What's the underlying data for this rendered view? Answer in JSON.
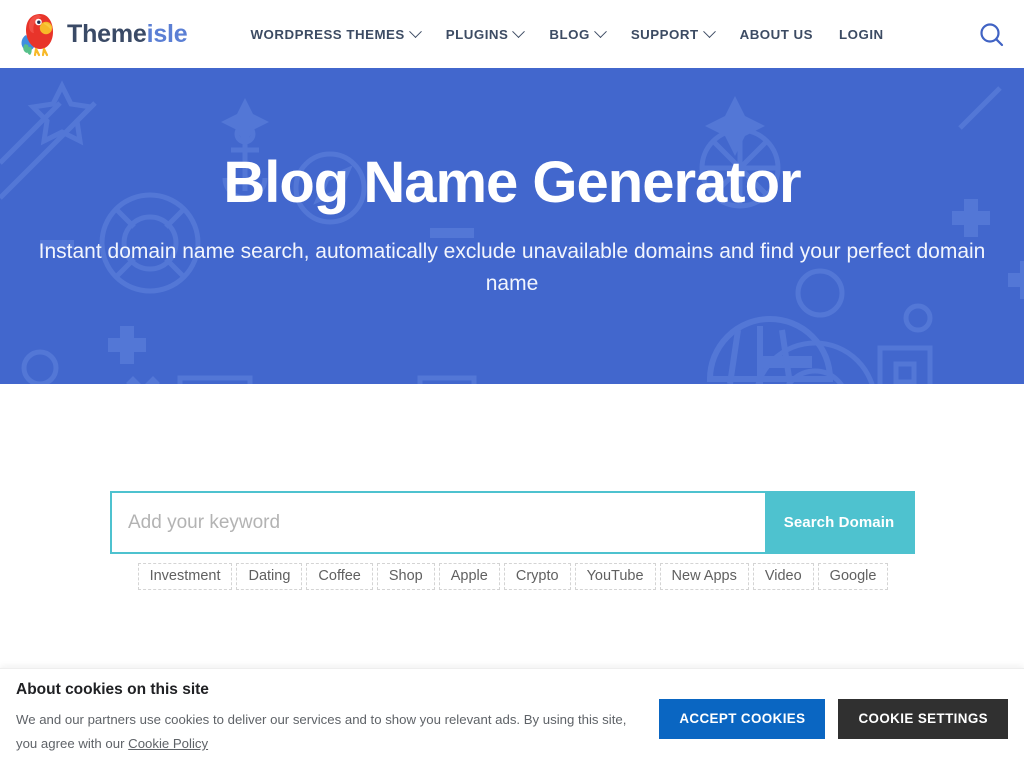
{
  "header": {
    "logo": {
      "icon": "parrot-logo-icon",
      "text_primary": "Theme",
      "text_secondary": "isle"
    },
    "nav_items": [
      {
        "label": "WORDPRESS THEMES",
        "has_dropdown": true
      },
      {
        "label": "PLUGINS",
        "has_dropdown": true
      },
      {
        "label": "BLOG",
        "has_dropdown": true
      },
      {
        "label": "SUPPORT",
        "has_dropdown": true
      },
      {
        "label": "ABOUT US",
        "has_dropdown": false
      },
      {
        "label": "LOGIN",
        "has_dropdown": false
      }
    ],
    "search_icon": "search-icon"
  },
  "hero": {
    "title": "Blog Name Generator",
    "subtitle": "Instant domain name search, automatically exclude unavailable domains and find your perfect domain name",
    "background_color": "#4267cd"
  },
  "search": {
    "placeholder": "Add your keyword",
    "value": "",
    "button_label": "Search Domain",
    "accent_color": "#4ec2cf",
    "suggestions": [
      "Investment",
      "Dating",
      "Coffee",
      "Shop",
      "Apple",
      "Crypto",
      "YouTube",
      "New Apps",
      "Video",
      "Google"
    ]
  },
  "cookie_banner": {
    "title": "About cookies on this site",
    "body_line1": "We and our partners use cookies to deliver our services and to show you relevant ads. By using this site,",
    "body_line2": "you agree with our ",
    "link_label": "Cookie Policy",
    "accept_label": "ACCEPT COOKIES",
    "settings_label": "COOKIE SETTINGS",
    "accept_color": "#0a66c2",
    "settings_color": "#303030"
  }
}
